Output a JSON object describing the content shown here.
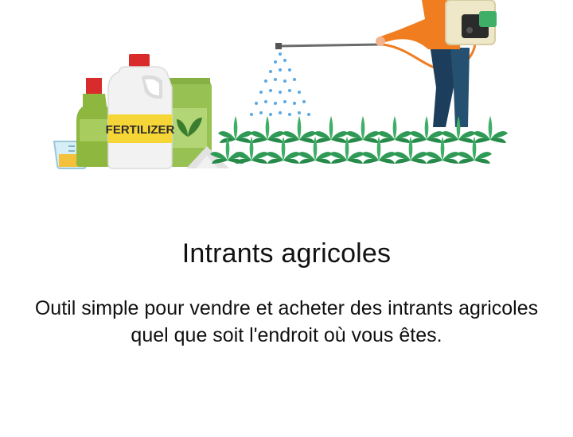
{
  "hero": {
    "product_label": "FERTILIZER",
    "colors": {
      "bottle_green": "#8db73e",
      "cap_red": "#d92b2b",
      "jug_white": "#f2f2f2",
      "label_yellow": "#f6d637",
      "bag_green": "#97c152",
      "plant_green": "#2f9a55",
      "spray_blue": "#5aa9e6",
      "shirt_orange": "#f07d1f",
      "pants_navy": "#1c3e5c"
    }
  },
  "intro": {
    "title": "Intrants agricoles",
    "description": "Outil simple pour vendre et acheter des intrants agricoles quel que soit l'endroit où vous êtes."
  }
}
